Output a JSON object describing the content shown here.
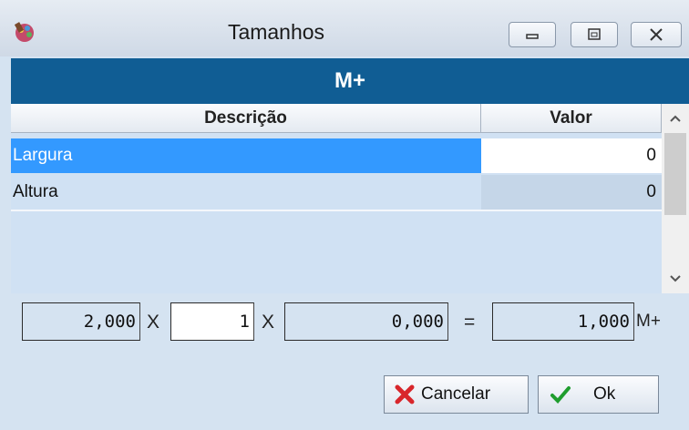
{
  "window": {
    "title": "Tamanhos",
    "header": "M+"
  },
  "icons": {
    "app": "paint-palette-icon",
    "minimize": "minimize-icon",
    "restore": "restore-icon",
    "close": "close-icon",
    "cancel": "x-icon",
    "ok": "checkmark-icon",
    "scroll_up": "chevron-up-icon",
    "scroll_down": "chevron-down-icon"
  },
  "table": {
    "columns": [
      "Descrição",
      "Valor"
    ],
    "rows": [
      {
        "label": "Largura",
        "value": "0"
      },
      {
        "label": "Altura",
        "value": "0"
      }
    ]
  },
  "formula": {
    "field1": "2,000",
    "op1": "X",
    "field2": "1",
    "op2": "X",
    "field3": "0,000",
    "equals": "=",
    "result": "1,000",
    "unit": "M+"
  },
  "buttons": {
    "cancel": "Cancelar",
    "ok": "Ok"
  },
  "colors": {
    "banner": "#105d94",
    "selection": "#3399ff",
    "panel": "#d5e3f1"
  }
}
